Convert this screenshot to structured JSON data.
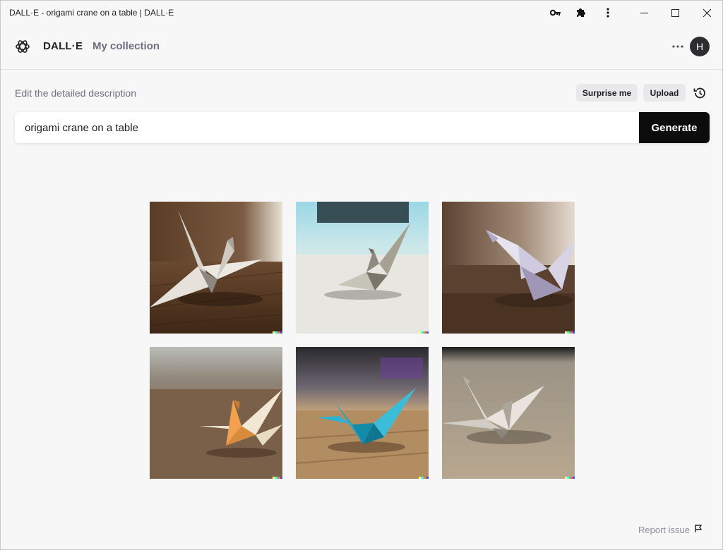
{
  "window": {
    "title": "DALL·E - origami crane on a table | DALL·E",
    "controls": [
      "minimize",
      "maximize",
      "close"
    ],
    "toolbar_icons": [
      "key-icon",
      "puzzle-icon",
      "kebab-menu-icon"
    ]
  },
  "header": {
    "brand": "DALL·E",
    "nav_collection": "My collection",
    "avatar_initial": "H"
  },
  "prompt": {
    "label": "Edit the detailed description",
    "surprise_label": "Surprise me",
    "upload_label": "Upload",
    "value": "origami crane on a table",
    "generate_label": "Generate"
  },
  "results": {
    "images": [
      {
        "subject": "white origami crane on dark wooden table"
      },
      {
        "subject": "grey origami crane on light table with blue background"
      },
      {
        "subject": "lavender origami crane on wooden table"
      },
      {
        "subject": "orange origami crane on wooden table"
      },
      {
        "subject": "teal origami crane on wooden table"
      },
      {
        "subject": "grey origami crane on light table"
      }
    ]
  },
  "footer": {
    "report_label": "Report issue"
  },
  "colors": {
    "background": "#f7f7f8",
    "generate_bg": "#0c0c0c",
    "pill_bg": "#e9e9ec",
    "muted_text": "#6e6e80"
  }
}
